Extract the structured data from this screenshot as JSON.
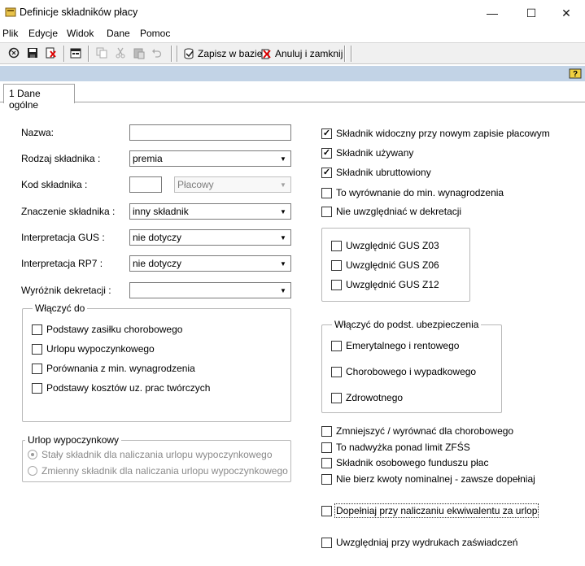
{
  "window": {
    "title": "Definicje składników płacy",
    "minimize": "—",
    "maximize": "☐",
    "close": "✕"
  },
  "menu": [
    "Plik",
    "Edycje",
    "Widok",
    "Dane",
    "Pomoc"
  ],
  "toolbar": {
    "save_db": "Zapisz w bazie",
    "cancel_close": "Anuluj i zamknij",
    "icons": [
      "refresh-icon",
      "save-disk-icon",
      "delete-icon",
      "properties-icon",
      "copy-icon",
      "cut-icon",
      "paste-icon",
      "undo-icon",
      "save-db-icon",
      "cancel-icon",
      "help-icon"
    ]
  },
  "tabs": [
    {
      "label": "1 Dane ogólne",
      "active": true
    }
  ],
  "form": {
    "nazwa": {
      "label": "Nazwa:",
      "value": ""
    },
    "rodzaj": {
      "label": "Rodzaj składnika :",
      "value": "premia"
    },
    "kod": {
      "label": "Kod składnika :",
      "value": "",
      "type_value": "Płacowy"
    },
    "znaczenie": {
      "label": "Znaczenie składnika :",
      "value": "inny składnik"
    },
    "gus": {
      "label": "Interpretacja GUS :",
      "value": "nie dotyczy"
    },
    "rp7": {
      "label": "Interpretacja RP7 :",
      "value": "nie dotyczy"
    },
    "dekretacja": {
      "label": "Wyróżnik dekretacji :",
      "value": ""
    }
  },
  "wlaczyc_do": {
    "title": "Włączyć do",
    "items": [
      {
        "label": "Podstawy zasiłku chorobowego",
        "checked": false
      },
      {
        "label": "Urlopu wypoczynkowego",
        "checked": false
      },
      {
        "label": "Porównania z min. wynagrodzenia",
        "checked": false
      },
      {
        "label": "Podstawy kosztów uz. prac twórczych",
        "checked": false
      }
    ]
  },
  "urlop": {
    "title": "Urlop wypoczynkowy",
    "options": [
      {
        "label": "Stały składnik dla naliczania urlopu wypoczynkowego",
        "selected": true
      },
      {
        "label": "Zmienny składnik dla naliczania urlopu wypoczynkowego",
        "selected": false
      }
    ]
  },
  "right_checks": [
    {
      "label": "Składnik widoczny przy nowym zapisie płacowym",
      "checked": true
    },
    {
      "label": "Składnik używany",
      "checked": true
    },
    {
      "label": "Składnik ubruttowiony",
      "checked": true
    },
    {
      "label": "To wyrównanie do min. wynagrodzenia",
      "checked": false
    },
    {
      "label": "Nie uwzględniać w dekretacji",
      "checked": false
    }
  ],
  "gus_group": [
    {
      "label": "Uwzględnić GUS Z03",
      "checked": false
    },
    {
      "label": "Uwzględnić GUS Z06",
      "checked": false
    },
    {
      "label": "Uwzględnić GUS Z12",
      "checked": false
    }
  ],
  "ubezp": {
    "title": "Włączyć do podst. ubezpieczenia",
    "items": [
      {
        "label": "Emerytalnego i rentowego",
        "checked": false
      },
      {
        "label": "Chorobowego i wypadkowego",
        "checked": false
      },
      {
        "label": "Zdrowotnego",
        "checked": false
      }
    ]
  },
  "bottom_checks": [
    {
      "label": "Zmniejszyć / wyrównać dla chorobowego",
      "checked": false
    },
    {
      "label": "To nadwyżka ponad limit ZFŚS",
      "checked": false
    },
    {
      "label": "Składnik osobowego funduszu płac",
      "checked": false
    },
    {
      "label": "Nie bierz kwoty nominalnej - zawsze dopełniaj",
      "checked": false
    },
    {
      "label": "Dopełniaj przy naliczaniu ekwiwalentu za urlop",
      "checked": false
    },
    {
      "label": "Uwzględniaj przy wydrukach zaświadczeń",
      "checked": false
    }
  ]
}
